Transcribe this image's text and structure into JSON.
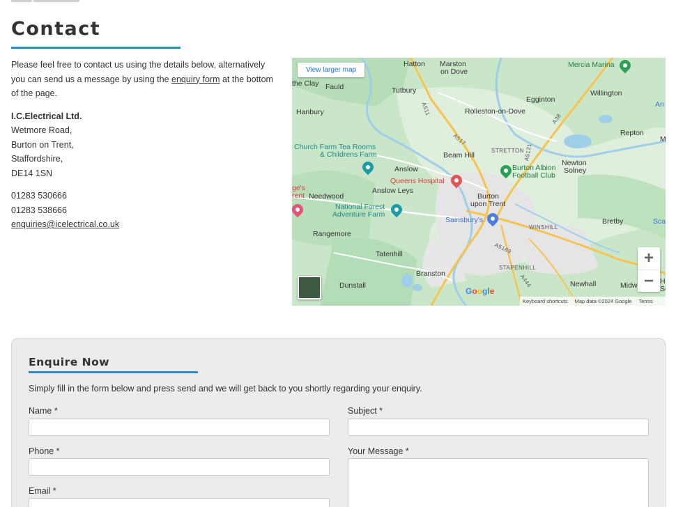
{
  "page": {
    "title": "Contact"
  },
  "contact": {
    "intro_before": "Please feel free to contact us using the details below, alternatively you can send us a message by using the ",
    "intro_link": "enquiry form",
    "intro_after": " at the bottom of the page.",
    "company": "I.C.Electrical Ltd.",
    "address": [
      "Wetmore Road,",
      "Burton on Trent,",
      "Staffordshire,",
      "DE14 1SN"
    ],
    "phone_1": "01283 530666",
    "phone_2": "01283 538666",
    "email": "enquiries@icelectrical.co.uk"
  },
  "map": {
    "larger_map_label": "View larger map",
    "zoom_in": "+",
    "zoom_out": "−",
    "google_logo": "Google",
    "footer": {
      "shortcuts": "Keyboard shortcuts",
      "data": "Map data ©2024 Google",
      "terms": "Terms"
    },
    "places": {
      "hatton": "Hatton",
      "marston": "Marston",
      "on_dove": "on Dove",
      "mercia_marina": "Mercia Marina",
      "clay": "the Clay",
      "fauld": "Fauld",
      "tutbury": "Tutbury",
      "willington": "Willington",
      "egginton": "Egginton",
      "hanbury": "Hanbury",
      "rolleston": "Rolleston-on-Dove",
      "repton": "Repton",
      "church_farm_1": "Church Farm Tea Rooms",
      "church_farm_2": "& Childrens Farm",
      "beam_hill": "Beam Hill",
      "stretton": "STRETTON",
      "newton": "Newton",
      "solney": "Solney",
      "anslow": "Anslow",
      "burton_albion_1": "Burton Albion",
      "burton_albion_2": "Football Club",
      "queens_hospital": "Queens Hospital",
      "ges": "ge's",
      "rent": "rent",
      "needwood": "Needwood",
      "anslow_leys": "Anslow Leys",
      "burton": "Burton",
      "upon_trent": "upon Trent",
      "national_forest_1": "National Forest",
      "national_forest_2": "Adventure Farm",
      "sainsburys": "Sainsbury's",
      "winshill": "WINSHILL",
      "bretby": "Bretby",
      "sca": "Sca",
      "rangemore": "Rangemore",
      "tatenhill": "Tatenhill",
      "stapenhill": "STAPENHILL",
      "branston": "Branston",
      "dunstall": "Dunstall",
      "newhall": "Newhall",
      "midw": "Midw",
      "an": "An",
      "m": "M",
      "h": "H",
      "so": "So",
      "a511": "A511",
      "a517": "A517",
      "a38": "A38",
      "a5121": "A5121",
      "a5189": "A5189",
      "a444": "A444"
    }
  },
  "enquire": {
    "title": "Enquire Now",
    "intro": "Simply fill in the form below and press send and we will get back to you shortly regarding your enquiry.",
    "name_label": "Name *",
    "subject_label": "Subject *",
    "phone_label": "Phone *",
    "message_label": "Your Message *",
    "email_label": "Email *"
  },
  "colors": {
    "accent": "#1f8ed0",
    "panel_bg": "#ececec",
    "map_green": "#c9e7c8"
  }
}
